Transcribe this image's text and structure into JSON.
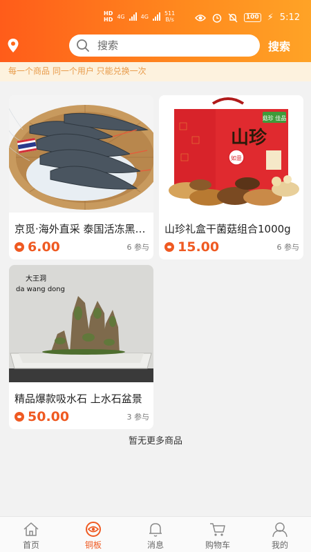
{
  "status_bar": {
    "network_hd_1": "HD",
    "network_hd_2": "HD",
    "net_type_1": "4G",
    "net_type_2": "4G",
    "speed_value": "511",
    "speed_unit": "B/s",
    "battery": "100",
    "time": "5:12"
  },
  "header": {
    "search_placeholder": "搜索",
    "search_button": "搜索"
  },
  "notice": "每一个商品 同一个用户 只能兑换一次",
  "products": [
    {
      "title": "京觅·海外直采 泰国活冻黑虎虾",
      "price": "6.00",
      "joined": "6 参与"
    },
    {
      "title": "山珍礼盒干菌菇组合1000g",
      "price": "15.00",
      "joined": "6 参与"
    },
    {
      "title": "精品爆款吸水石 上水石盆景",
      "price": "50.00",
      "joined": "3 参与",
      "image_caption_cn": "大王洞",
      "image_caption_pinyin": "da wang dong"
    }
  ],
  "product_images": {
    "gift_box_label": "山珍",
    "gift_box_sub": "如意",
    "gift_box_tag": "菇珍 佳品"
  },
  "no_more": "暂无更多商品",
  "tabbar": [
    {
      "label": "首页",
      "icon": "home-icon",
      "active": false
    },
    {
      "label": "铜板",
      "icon": "coin-icon",
      "active": true
    },
    {
      "label": "消息",
      "icon": "bell-icon",
      "active": false
    },
    {
      "label": "购物车",
      "icon": "cart-icon",
      "active": false
    },
    {
      "label": "我的",
      "icon": "user-icon",
      "active": false
    }
  ],
  "colors": {
    "accent": "#ef5a22",
    "header_start": "#ff5c1a",
    "header_end": "#ffa326",
    "notice_bg": "#fdf2de",
    "notice_text": "#e89b4a"
  }
}
